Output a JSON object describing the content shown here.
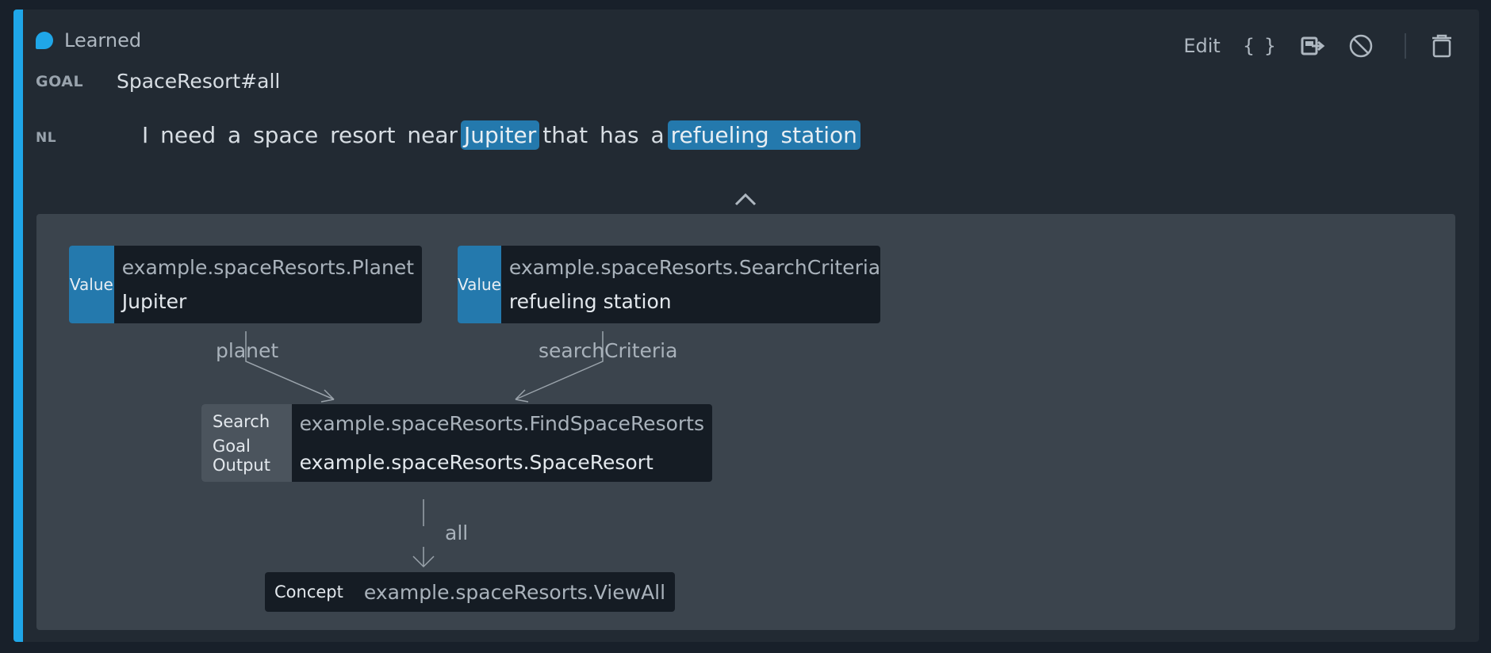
{
  "header": {
    "status_label": "Learned",
    "actions": {
      "edit_label": "Edit",
      "json_label": "{ }",
      "export_icon": "export-icon",
      "disable_icon": "disable-icon",
      "delete_icon": "trash-icon"
    }
  },
  "goal": {
    "label": "GOAL",
    "value": "SpaceResort#all"
  },
  "nl": {
    "label": "NL",
    "segments": [
      {
        "text": "I need a space resort near",
        "highlight": false
      },
      {
        "text": "Jupiter",
        "highlight": true
      },
      {
        "text": "that has a",
        "highlight": false
      },
      {
        "text": "refueling station",
        "highlight": true
      }
    ]
  },
  "graph": {
    "planet_node": {
      "kind": "Value",
      "type": "example.spaceResorts.Planet",
      "value": "Jupiter"
    },
    "criteria_node": {
      "kind": "Value",
      "type": "example.spaceResorts.SearchCriteria",
      "value": "refueling station"
    },
    "search_node": {
      "kind": "Search",
      "output_label": "Goal Output",
      "action": "example.spaceResorts.FindSpaceResorts",
      "output": "example.spaceResorts.SpaceResort"
    },
    "concept_node": {
      "kind": "Concept",
      "type": "example.spaceResorts.ViewAll"
    },
    "edges": {
      "planet": "planet",
      "criteria": "searchCriteria",
      "all": "all"
    }
  },
  "colors": {
    "accent": "#1fa6e8",
    "token": "#2479ad",
    "background": "#222a33"
  }
}
